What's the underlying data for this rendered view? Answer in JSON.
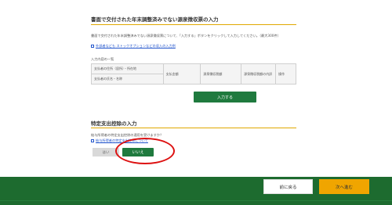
{
  "withholding_section": {
    "title": "書面で交付された年末調整済みでない源泉徴収票の入力",
    "instruction": "書面で交付された年末調整済みでない源泉徴収票について、「入力する」ボタンをクリックして入力してください。（最大300件）",
    "help_link": "外部者なども ストックオプションなどの収入の入力例",
    "list_label": "入力内容の一覧",
    "table": {
      "headers": [
        "支払者の住所（居所）・所在地",
        "支払金額",
        "源泉徴収税額",
        "源泉徴収税額の内訳",
        "操作"
      ],
      "subheader": "支払者の氏名・名称"
    },
    "enter_button": "入力する"
  },
  "special_deduction_section": {
    "title": "特定支出控除の入力",
    "question": "給与所得者の特定支出控除の適用を受けますか？",
    "help_link": "給与所得者の特定支出控除について",
    "yes_label": "はい",
    "no_label": "いいえ"
  },
  "footer": {
    "prev_label": "前に戻る",
    "next_label": "次へ進む"
  },
  "colors": {
    "accent_green": "#1f7a3e",
    "footer_green": "#1d6b2f",
    "rule_gold": "#e0a800",
    "next_button": "#f0a500",
    "annotation_red": "#dd1111"
  }
}
